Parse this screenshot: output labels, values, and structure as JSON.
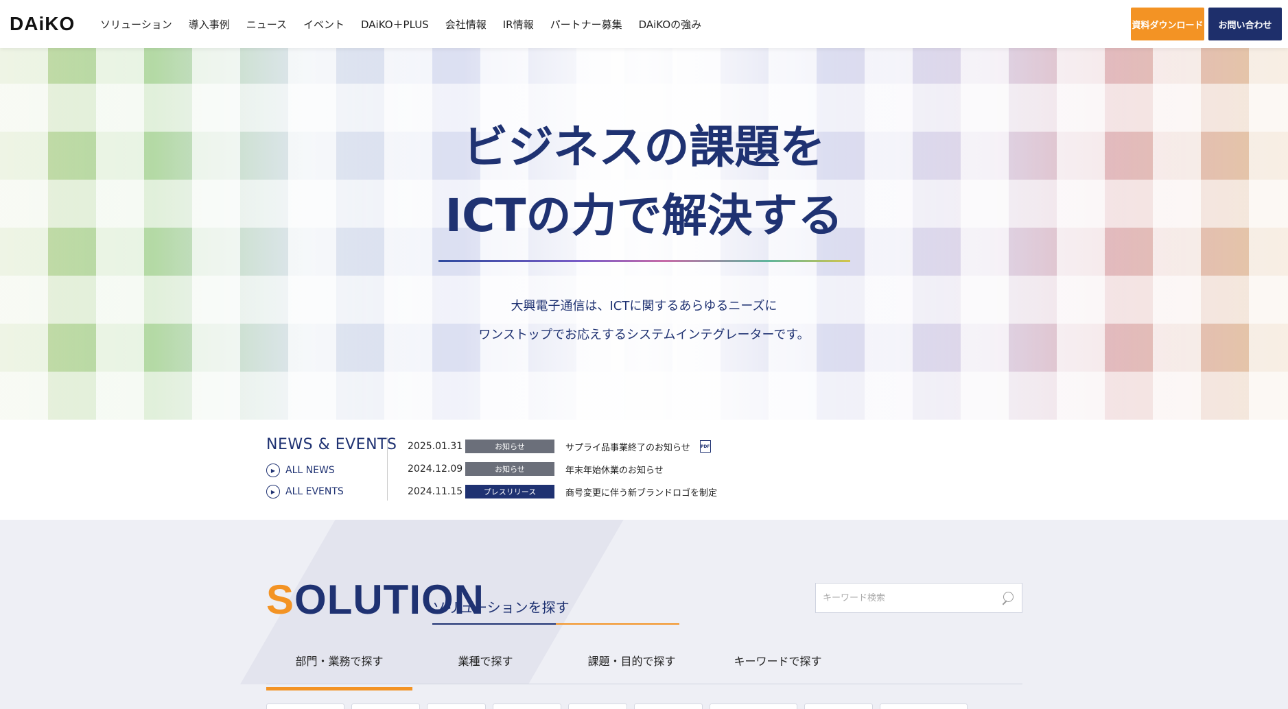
{
  "header": {
    "logo": "DAiKO",
    "nav": [
      "ソリューション",
      "導入事例",
      "ニュース",
      "イベント",
      "DAiKO＋PLUS",
      "会社情報",
      "IR情報",
      "パートナー募集",
      "DAiKOの強み"
    ],
    "download_label": "資料ダウンロード",
    "contact_label": "お問い合わせ"
  },
  "hero": {
    "title_line1": "ビジネスの課題を",
    "title_line2": "ICTの力で解決する",
    "sub_line1": "大興電子通信は、ICTに関するあらゆるニーズに",
    "sub_line2": "ワンストップでお応えするシステムインテグレーターです。"
  },
  "news": {
    "heading": "NEWS & EVENTS",
    "all_news": "ALL NEWS",
    "all_events": "ALL EVENTS",
    "items": [
      {
        "date": "2025.01.31",
        "badge": "お知らせ",
        "badge_color": "#6b6f7a",
        "title": "サプライ品事業終了のお知らせ",
        "pdf": true
      },
      {
        "date": "2024.12.09",
        "badge": "お知らせ",
        "badge_color": "#6b6f7a",
        "title": "年末年始休業のお知らせ",
        "pdf": false
      },
      {
        "date": "2024.11.15",
        "badge": "プレスリリース",
        "badge_color": "#1f3272",
        "title": "商号変更に伴う新ブランドロゴを制定",
        "pdf": false
      }
    ]
  },
  "solution": {
    "title_first": "S",
    "title_rest": "OLUTION",
    "subtitle": "ソリューションを探す",
    "search_placeholder": "キーワード検索",
    "tabs": [
      "部門・業務で探す",
      "業種で探す",
      "課題・目的で探す",
      "キーワードで探す"
    ]
  },
  "colors": {
    "navy": "#1f3272",
    "orange": "#f39324"
  }
}
